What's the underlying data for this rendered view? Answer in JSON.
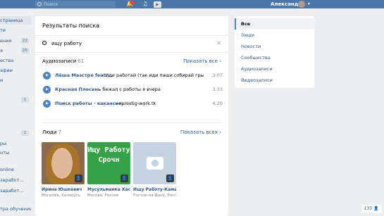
{
  "topbar": {
    "search_placeholder": "Поиск",
    "user_name": "Александр"
  },
  "leftnav": {
    "items": [
      {
        "label": "страница",
        "badge": ""
      },
      {
        "label": "ти",
        "badge": ""
      },
      {
        "label": "ения",
        "badge": "22"
      },
      {
        "label": "я",
        "badge": "25"
      },
      {
        "label": "ества",
        "badge": ""
      },
      {
        "label": "афии",
        "badge": ""
      },
      {
        "label": "и",
        "badge": ""
      },
      {
        "label": "",
        "badge": "1"
      },
      {
        "label": "",
        "badge": "1"
      },
      {
        "label": "ры",
        "badge": ""
      },
      {
        "label": "нты",
        "badge": ""
      },
      {
        "label": "online",
        "badge": ""
      },
      {
        "label": "заработ...",
        "badge": ""
      },
      {
        "label": "заработ...",
        "badge": ""
      },
      {
        "label": "тра обучение",
        "badge": ""
      }
    ]
  },
  "main": {
    "title": "Результаты поиска",
    "query": "ищу работу",
    "audio": {
      "heading": "Аудиозаписи",
      "count": "61",
      "show_all": "Показать все",
      "tracks": [
        {
          "artist": "Лёша Маэстро feat....",
          "title": "– Иди работай (так иди паши собирай грыши...",
          "duration": "3:07"
        },
        {
          "artist": "Красная Плесень",
          "title": "– бежал с работы я вчера",
          "duration": "3:33"
        },
        {
          "artist": "Поиск работы - вакансии",
          "title": "– prestig-work.tk",
          "duration": "4:20"
        }
      ]
    },
    "people": {
      "heading": "Люди",
      "count": "7",
      "show_all": "Показать всех",
      "list": [
        {
          "name": "Ирина Юшкевич",
          "city": "Могилёв, Беларусь",
          "photo_text": ""
        },
        {
          "name": "Мусульманка Хася...",
          "city": "Москва, Россия",
          "photo_text": "Ищу Работу Срочн"
        },
        {
          "name": "Ищу Работу-Камаз...",
          "city": "Ростов-на-Дону, Россия",
          "photo_text": ""
        }
      ]
    }
  },
  "filters": {
    "items": [
      "Все",
      "Люди",
      "Новости",
      "Сообщества",
      "Аудиозаписи",
      "Видеозаписи"
    ]
  },
  "bottom_chip": "133"
}
